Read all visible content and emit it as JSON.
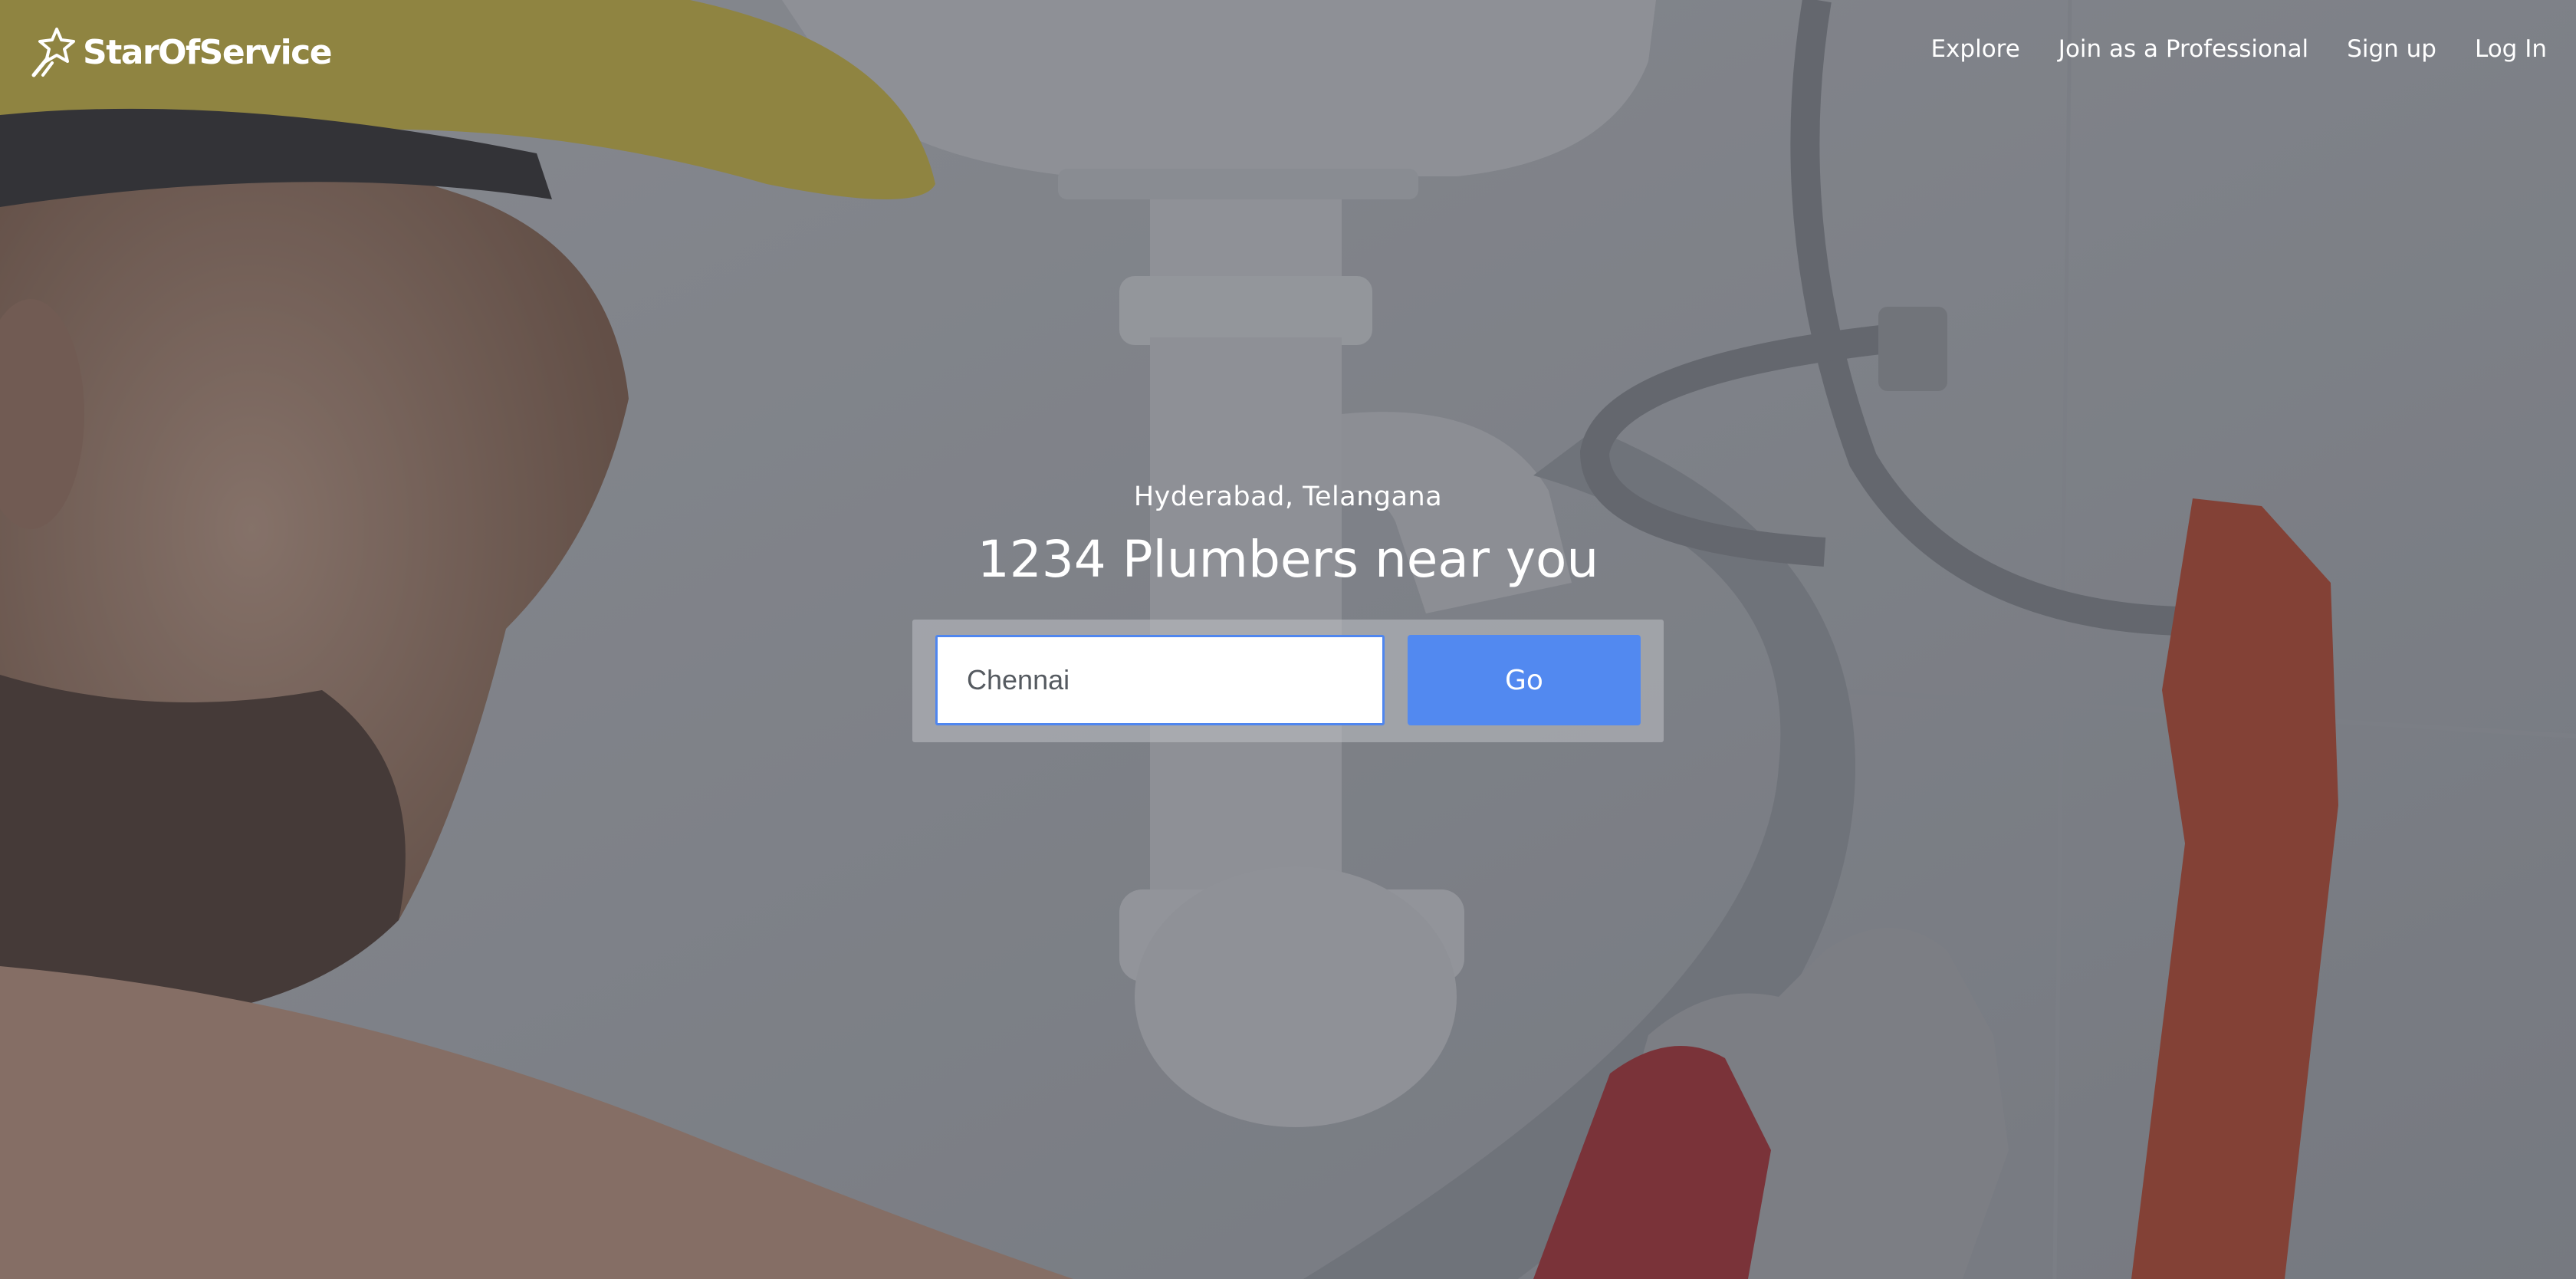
{
  "brand": {
    "name": "StarOfService",
    "logo_icon": "star-runner-icon"
  },
  "nav": {
    "items": [
      {
        "label": "Explore"
      },
      {
        "label": "Join as a Professional"
      },
      {
        "label": "Sign up"
      },
      {
        "label": "Log In"
      }
    ]
  },
  "hero": {
    "location": "Hyderabad, Telangana",
    "headline": "1234 Plumbers near you"
  },
  "search": {
    "value": "Chennai",
    "button_label": "Go"
  },
  "colors": {
    "accent": "#5289f0",
    "input_border": "#4f86ef",
    "text_light": "#ffffff"
  }
}
